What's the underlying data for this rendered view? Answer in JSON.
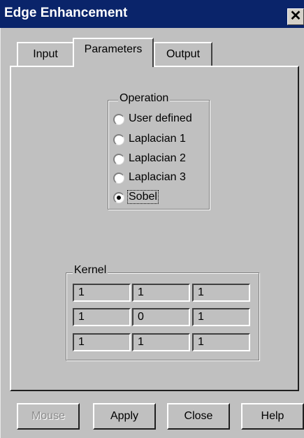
{
  "window": {
    "title": "Edge Enhancement",
    "close_label": "✕"
  },
  "tabs": [
    {
      "label": "Input",
      "selected": false
    },
    {
      "label": "Parameters",
      "selected": true
    },
    {
      "label": "Output",
      "selected": false
    }
  ],
  "operation": {
    "label": "Operation",
    "options": [
      "User defined",
      "Laplacian 1",
      "Laplacian 2",
      "Laplacian 3",
      "Sobel"
    ],
    "selected": "Sobel"
  },
  "kernel": {
    "label": "Kernel",
    "rows": [
      [
        "1",
        "1",
        "1"
      ],
      [
        "1",
        "0",
        "1"
      ],
      [
        "1",
        "1",
        "1"
      ]
    ]
  },
  "buttons": {
    "mouse": "Mouse",
    "apply": "Apply",
    "close": "Close",
    "help": "Help"
  },
  "colors": {
    "titlebar": "#0a246a",
    "face": "#c0c0c0",
    "disabled_text": "#8a8a8a"
  }
}
